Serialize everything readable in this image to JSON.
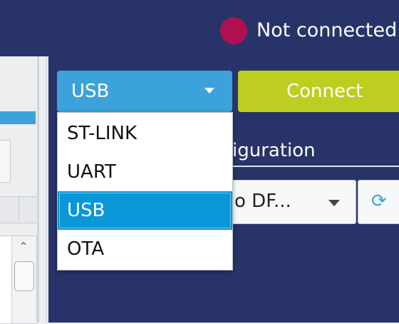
{
  "header": {
    "status_text": "Not connected",
    "status_color": "#b0104f",
    "background": "#283469"
  },
  "connection": {
    "interface_select": {
      "value": "USB",
      "options": [
        "ST-LINK",
        "UART",
        "USB",
        "OTA"
      ],
      "selected_index": 2
    },
    "connect_label": "Connect",
    "config_tab_label": "iguration",
    "port_select_value": "o DF...",
    "refresh_icon": "refresh-icon"
  },
  "colors": {
    "accent_blue": "#3ca2dc",
    "connect_green": "#bdce21",
    "selected_option": "#0a97d8"
  }
}
